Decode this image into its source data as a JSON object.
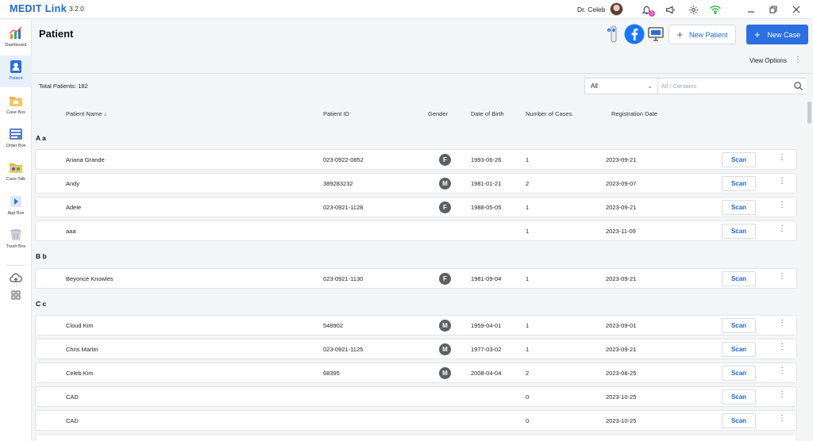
{
  "app": {
    "logo": "MEDIT Link",
    "version": "3.2.0",
    "user": "Dr. Celeb"
  },
  "titlebar": {
    "notification_count": "1"
  },
  "sidebar": {
    "items": [
      {
        "label": "Dashboard",
        "icon": "dashboard-icon"
      },
      {
        "label": "Patient",
        "icon": "patient-icon",
        "active": true
      },
      {
        "label": "Case Box",
        "icon": "case-box-icon"
      },
      {
        "label": "Order Box",
        "icon": "order-box-icon"
      },
      {
        "label": "Case Talk",
        "icon": "case-talk-icon"
      },
      {
        "label": "App Box",
        "icon": "app-box-icon"
      },
      {
        "label": "Trash Box",
        "icon": "trash-box-icon"
      }
    ]
  },
  "header": {
    "title": "Patient",
    "new_patient_label": "New Patient",
    "new_case_label": "New Case",
    "view_options_label": "View Options"
  },
  "list": {
    "total_label": "Total Patients: 182",
    "filter_value": "All",
    "search_placeholder": "All / Contains",
    "columns": {
      "name": "Patient Name",
      "id": "Patient ID",
      "gender": "Gender",
      "dob": "Date of Birth",
      "cases": "Number of Cases",
      "reg": "Registration Date"
    },
    "scan_label": "Scan",
    "groups": [
      {
        "letter": "A a",
        "patients": [
          {
            "name": "Ariana Grande",
            "id": "023-0922-0852",
            "gender": "F",
            "dob": "1993-06-26",
            "cases": "1",
            "reg": "2023-09-21"
          },
          {
            "name": "Andy",
            "id": "389283232",
            "gender": "M",
            "dob": "1981-01-21",
            "cases": "2",
            "reg": "2023-09-07"
          },
          {
            "name": "Adele",
            "id": "023-0921-1128",
            "gender": "F",
            "dob": "1988-05-05",
            "cases": "1",
            "reg": "2023-09-21"
          },
          {
            "name": "aaa",
            "id": "",
            "gender": "",
            "dob": "",
            "cases": "1",
            "reg": "2023-11-09"
          }
        ]
      },
      {
        "letter": "B b",
        "patients": [
          {
            "name": "Beyoncé Knowles",
            "id": "023-0921-1130",
            "gender": "F",
            "dob": "1981-09-04",
            "cases": "1",
            "reg": "2023-09-21"
          }
        ]
      },
      {
        "letter": "C c",
        "patients": [
          {
            "name": "Cloud Kim",
            "id": "548902",
            "gender": "M",
            "dob": "1959-04-01",
            "cases": "1",
            "reg": "2023-09-01"
          },
          {
            "name": "Chris Martin",
            "id": "023-0921-1125",
            "gender": "M",
            "dob": "1977-03-02",
            "cases": "1",
            "reg": "2023-09-21"
          },
          {
            "name": "Celeb.Kim",
            "id": "68395",
            "gender": "M",
            "dob": "2008-04-04",
            "cases": "2",
            "reg": "2023-08-25"
          },
          {
            "name": "CAD",
            "id": "",
            "gender": "",
            "dob": "",
            "cases": "0",
            "reg": "2023-10-25"
          },
          {
            "name": "CAD",
            "id": "",
            "gender": "",
            "dob": "",
            "cases": "0",
            "reg": "2023-10-25"
          }
        ]
      }
    ]
  }
}
